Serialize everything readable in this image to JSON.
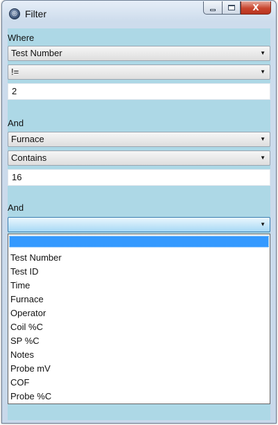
{
  "window": {
    "title": "Filter",
    "icon": "app-icon"
  },
  "caption": {
    "minimize_icon": "minimize-icon",
    "maximize_icon": "maximize-icon",
    "close_label": "X"
  },
  "filter1": {
    "label": "Where",
    "field": "Test Number",
    "operator": "!=",
    "value": "2"
  },
  "filter2": {
    "label": "And",
    "field": "Furnace",
    "operator": "Contains",
    "value": "16"
  },
  "filter3": {
    "label": "And",
    "field": ""
  },
  "dropdown": {
    "selected": "",
    "items": [
      "Test Number",
      "Test ID",
      "Time",
      "Furnace",
      "Operator",
      "Coil %C",
      "SP %C",
      "Notes",
      "Probe mV",
      "COF",
      "Probe %C"
    ]
  },
  "colors": {
    "background": "#add8e6",
    "selection": "#3399ff",
    "close_button": "#c9462e"
  }
}
